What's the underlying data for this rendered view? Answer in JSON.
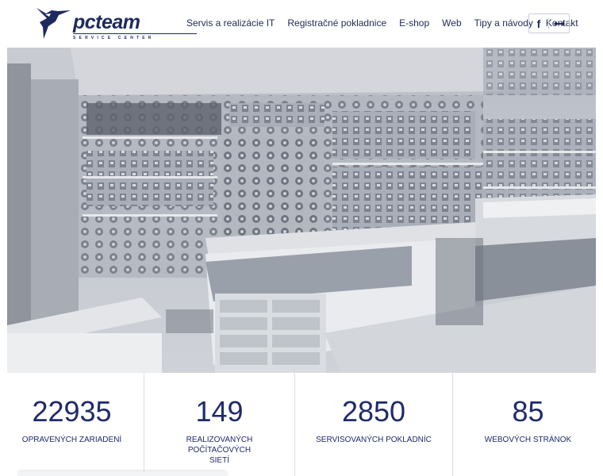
{
  "brand": {
    "name": "pcteam",
    "tagline": "SERVICE CENTER"
  },
  "nav": {
    "items": [
      {
        "label": "Servis a realizácie IT"
      },
      {
        "label": "Registračné pokladnice"
      },
      {
        "label": "E-shop"
      },
      {
        "label": "Web"
      },
      {
        "label": "Tipy a návody"
      },
      {
        "label": "Kontakt"
      }
    ]
  },
  "social": {
    "facebook_icon": "facebook-icon",
    "menu_icon": "double-arrow-icon"
  },
  "hero": {
    "image": "store-interior-photo"
  },
  "stats": [
    {
      "number": "22935",
      "label": "OPRAVENÝCH ZARIADENÍ"
    },
    {
      "number": "149",
      "label": "REALIZOVANÝCH POČÍTAČOVÝCH SIETÍ"
    },
    {
      "number": "2850",
      "label": "SERVISOVANÝCH POKLADNÍC"
    },
    {
      "number": "85",
      "label": "WEBOVÝCH STRÁNOK"
    }
  ],
  "colors": {
    "brand": "#1e2a5e",
    "stat_text": "#1f2a6b",
    "hero_tint": "#c2c6cd"
  }
}
